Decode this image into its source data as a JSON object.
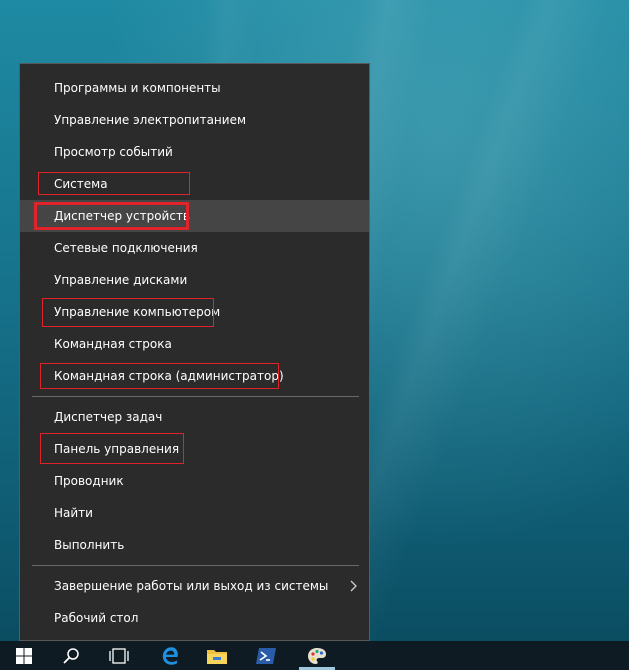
{
  "menu": {
    "items": [
      {
        "label": "Программы и компоненты"
      },
      {
        "label": "Управление электропитанием"
      },
      {
        "label": "Просмотр событий"
      },
      {
        "label": "Система"
      },
      {
        "label": "Диспетчер устройств"
      },
      {
        "label": "Сетевые подключения"
      },
      {
        "label": "Управление дисками"
      },
      {
        "label": "Управление компьютером"
      },
      {
        "label": "Командная строка"
      },
      {
        "label": "Командная строка (администратор)"
      },
      {
        "label": "Диспетчер задач"
      },
      {
        "label": "Панель управления"
      },
      {
        "label": "Проводник"
      },
      {
        "label": "Найти"
      },
      {
        "label": "Выполнить"
      },
      {
        "label": "Завершение работы или выход из системы"
      },
      {
        "label": "Рабочий стол"
      }
    ],
    "hovered_item": "Диспетчер устройств",
    "highlighted_items": [
      "Система",
      "Диспетчер устройств",
      "Управление компьютером",
      "Командная строка (администратор)",
      "Панель управления"
    ]
  },
  "taskbar": {
    "icons": [
      "windows-start-icon",
      "search-icon",
      "task-view-icon",
      "edge-browser-icon",
      "file-explorer-icon",
      "powershell-icon",
      "paint-palette-icon"
    ]
  },
  "colors": {
    "menu_bg": "#2b2b2b",
    "hover_bg": "#454545",
    "highlight_border": "#e0222a",
    "taskbar_bg": "#0f1b22",
    "desktop": "#1a7f98"
  }
}
